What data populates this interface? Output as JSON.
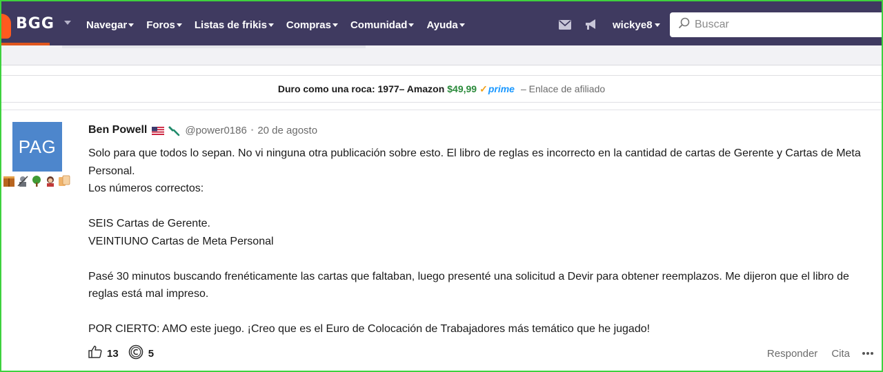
{
  "nav": {
    "logo": "BGG",
    "items": [
      {
        "label": "Navegar"
      },
      {
        "label": "Foros"
      },
      {
        "label": "Listas de frikis"
      },
      {
        "label": "Compras"
      },
      {
        "label": "Comunidad"
      },
      {
        "label": "Ayuda"
      }
    ],
    "icons": [
      "mail-icon",
      "megaphone-icon"
    ],
    "username": "wickye8",
    "search_placeholder": "Buscar",
    "bg_color": "#3f3a60"
  },
  "affiliate": {
    "title": "Duro como una roca: 1977– Amazon",
    "price": "$49,99",
    "prime": "prime",
    "note": "– Enlace de afiliado"
  },
  "post": {
    "avatar_text": "PAG",
    "avatar_color": "#4d86cc",
    "author": "Ben Powell",
    "handle": "@power0186",
    "date": "20 de agosto",
    "body": [
      "Solo para que todos lo sepan. No vi ninguna otra publicación sobre esto. El libro de reglas es incorrecto en la cantidad de cartas de Gerente y Cartas de Meta Personal.",
      "Los números correctos:",
      "",
      "SEIS Cartas de Gerente.",
      "VEINTIUNO Cartas de Meta Personal",
      "",
      "Pasé 30 minutos buscando frenéticamente las cartas que faltaban, luego presenté una solicitud a Devir para obtener reemplazos. Me dijeron que el libro de reglas está mal impreso.",
      "",
      "POR CIERTO: AMO este juego. ¡Creo que es el Euro de Colocación de Trabajadores más temático que he jugado!"
    ],
    "likes": "13",
    "geekgold": "5",
    "reply_label": "Responder",
    "quote_label": "Cita"
  }
}
